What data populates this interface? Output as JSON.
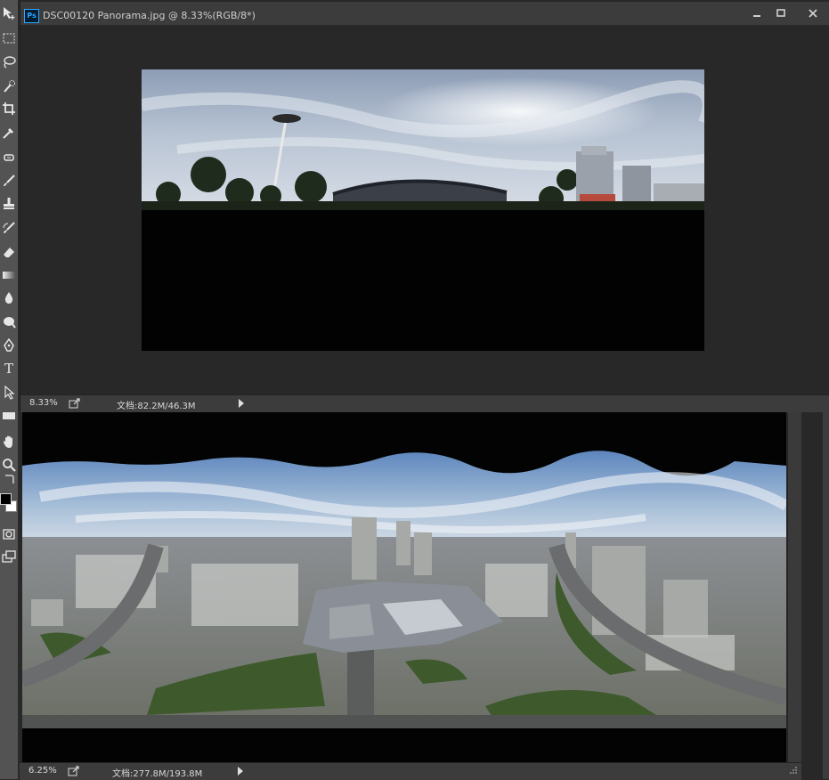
{
  "app": {
    "icon_label": "Ps"
  },
  "doc1": {
    "title": "DSC00120 Panorama.jpg @ 8.33%(RGB/8*)",
    "status": {
      "zoom": "8.33%",
      "doc_info": "文档:82.2M/46.3M"
    }
  },
  "doc2": {
    "status": {
      "zoom": "6.25%",
      "doc_info": "文档:277.8M/193.8M"
    }
  },
  "tools": [
    "move-tool",
    "marquee-tool",
    "lasso-tool",
    "quick-selection-tool",
    "crop-tool",
    "eyedropper-tool",
    "spot-healing-tool",
    "brush-tool",
    "clone-stamp-tool",
    "history-brush-tool",
    "eraser-tool",
    "gradient-tool",
    "blur-tool",
    "dodge-tool",
    "pen-tool",
    "type-tool",
    "path-selection-tool",
    "rectangle-tool",
    "hand-tool",
    "zoom-tool"
  ],
  "tool_glyphs": {
    "type-tool": "T"
  },
  "colors": {
    "foreground": "#000000",
    "background": "#ffffff",
    "workspace": "#282828",
    "panel": "#535353",
    "ps_blue": "#31a8ff"
  }
}
